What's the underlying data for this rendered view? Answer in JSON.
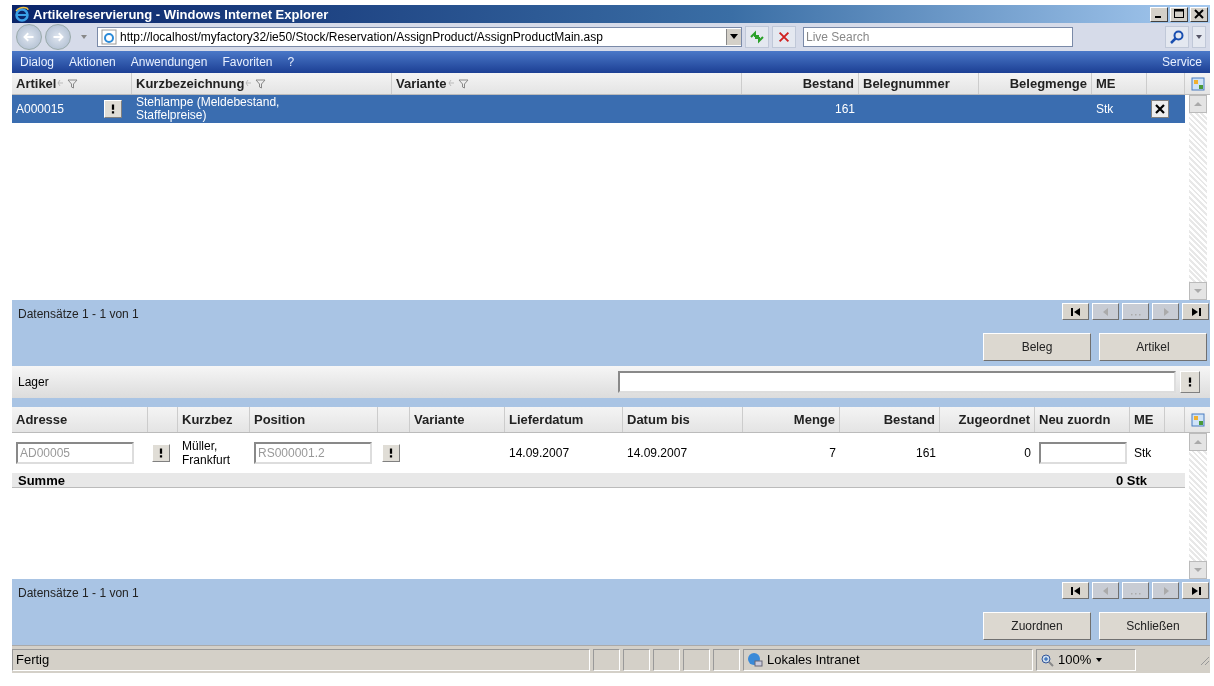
{
  "window": {
    "title": "Artikelreservierung - Windows Internet Explorer"
  },
  "address_bar": {
    "url": "http://localhost/myfactory32/ie50/Stock/Reservation/AssignProduct/AssignProductMain.asp"
  },
  "search": {
    "placeholder": "Live Search"
  },
  "menu": {
    "items": [
      "Dialog",
      "Aktionen",
      "Anwendungen",
      "Favoriten",
      "?"
    ],
    "right": "Service"
  },
  "articles": {
    "columns": [
      {
        "label": "Artikel",
        "filterable": true
      },
      {
        "label": "Kurzbezeichnung",
        "filterable": true
      },
      {
        "label": "Variante",
        "filterable": true
      },
      {
        "label": "Bestand",
        "filterable": false
      },
      {
        "label": "Belegnummer",
        "filterable": false
      },
      {
        "label": "Belegmenge",
        "filterable": false
      },
      {
        "label": "ME",
        "filterable": false
      }
    ],
    "rows": [
      {
        "artikel": "A000015",
        "kurzbezeichnung": "Stehlampe (Meldebestand, Staffelpreise)",
        "bestand": "161",
        "me": "Stk",
        "selected": true
      }
    ],
    "records": "Datensätze 1 - 1 von 1",
    "pager": [
      {
        "kind": "first",
        "disabled": false
      },
      {
        "kind": "prev",
        "disabled": true
      },
      {
        "kind": "more",
        "disabled": true
      },
      {
        "kind": "next",
        "disabled": true
      },
      {
        "kind": "last",
        "disabled": false
      }
    ],
    "buttons": [
      "Beleg",
      "Artikel"
    ]
  },
  "lager": {
    "label": "Lager"
  },
  "assignments": {
    "columns": [
      "Adresse",
      "Kurzbez",
      "Position",
      "Variante",
      "Lieferdatum",
      "Datum bis",
      "Menge",
      "Bestand",
      "Zugeordnet",
      "Neu zuordn",
      "ME"
    ],
    "rows": [
      {
        "adresse": "AD00005",
        "kurzbez": "Müller, Frankfurt",
        "position": "RS000001.2",
        "lieferdatum": "14.09.2007",
        "datum_bis": "14.09.2007",
        "menge": "7",
        "bestand": "161",
        "zugeordnet": "0",
        "me": "Stk"
      }
    ],
    "sum_label": "Summe",
    "sum_total": "0 Stk",
    "records": "Datensätze 1 - 1 von 1",
    "pager": [
      {
        "kind": "first",
        "disabled": false
      },
      {
        "kind": "prev",
        "disabled": true
      },
      {
        "kind": "more",
        "disabled": true
      },
      {
        "kind": "next",
        "disabled": true
      },
      {
        "kind": "last",
        "disabled": false
      }
    ],
    "buttons": [
      "Zuordnen",
      "Schließen"
    ]
  },
  "status_bar": {
    "text": "Fertig",
    "zone": "Lokales Intranet",
    "zoom": "100%"
  }
}
